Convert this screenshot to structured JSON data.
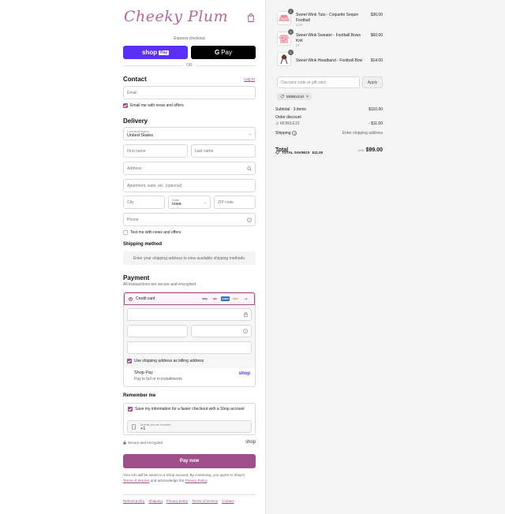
{
  "brand": {
    "logo": "Cheeky Plum",
    "accent": "#a04f8d"
  },
  "express": {
    "title": "Express checkout",
    "shop_pay": "shop",
    "shop_pay_badge": "Pay",
    "google_pay": "Pay",
    "google_g": "G",
    "or": "OR"
  },
  "contact": {
    "heading": "Contact",
    "login": "Log in",
    "email_placeholder": "Email",
    "newsletter": "Email me with news and offers"
  },
  "delivery": {
    "heading": "Delivery",
    "country_label": "Country/Region",
    "country_value": "United States",
    "first_name": "First name",
    "last_name": "Last name",
    "address": "Address",
    "apartment": "Apartment, suite, etc. (optional)",
    "city": "City",
    "state_label": "State",
    "state_value": "Iowa",
    "zip": "ZIP code",
    "phone": "Phone",
    "text_me": "Text me with news and offers"
  },
  "shipping_method": {
    "heading": "Shipping method",
    "message": "Enter your shipping address to view available shipping methods."
  },
  "payment": {
    "heading": "Payment",
    "hint": "All transactions are secure and encrypted.",
    "credit_card": "Credit card",
    "cards": [
      "VISA",
      "MC",
      "AMEX",
      "DISC",
      "+4"
    ],
    "billing_same": "Use shipping address as billing address",
    "shop_pay": "Shop Pay",
    "shop_pay_sub": "Pay in full or in installments",
    "shop_logo": "shop"
  },
  "remember": {
    "heading": "Remember me",
    "save_info": "Save my information for a faster checkout with a Shop account",
    "mobile_label": "Mobile phone number",
    "mobile_prefix": "+1",
    "secure": "Secure and encrypted",
    "shop_logo": "shop"
  },
  "pay_now": "Pay now",
  "legal": {
    "text": "Your info will be saved to a Shop account. By continuing, you agree to Shop's",
    "terms": "Terms of Service",
    "mid": "and acknowledge the",
    "privacy": "Privacy Policy",
    "end": "."
  },
  "footer": [
    "Refund policy",
    "Shipping",
    "Privacy policy",
    "Terms of service",
    "Contact"
  ],
  "cart": {
    "items": [
      {
        "qty": "1",
        "name": "Sweet Wink Tutu - Coquette Sequin Football",
        "variant": "1-2Y",
        "price": "$36.00"
      },
      {
        "qty": "1",
        "name": "Sweet Wink Sweater - Football Bows Knit",
        "variant": "2T",
        "price": "$60.00"
      },
      {
        "qty": "1",
        "name": "Sweet Wink Headband - Football Bow",
        "variant": "",
        "price": "$14.00"
      }
    ],
    "discount_placeholder": "Discount code or gift card",
    "apply": "Apply",
    "code": "MOBILE10",
    "subtotal_label": "Subtotal · 3 items",
    "subtotal": "$110.00",
    "order_discount_label": "Order discount",
    "discount_code": "MOBILE10",
    "discount_value": "- $11.00",
    "shipping_label": "Shipping",
    "shipping_value": "Enter shipping address",
    "total_label": "Total",
    "currency": "USD",
    "total": "$99.00",
    "savings_label": "TOTAL SAVINGS",
    "savings": "$11.00"
  }
}
